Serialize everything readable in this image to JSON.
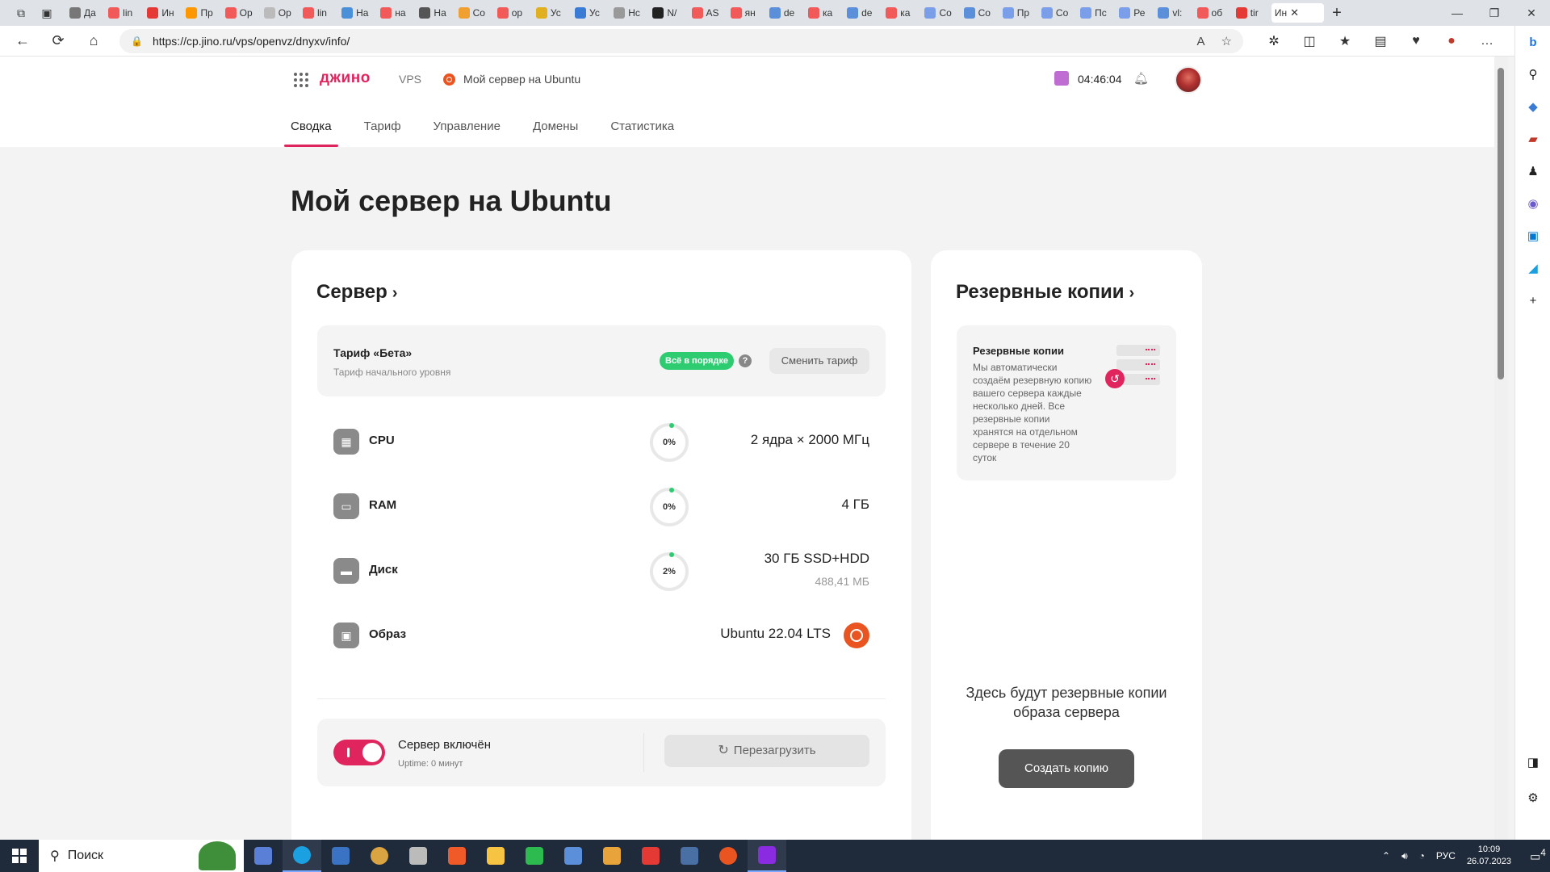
{
  "browser": {
    "tabs": [
      {
        "label": "Да",
        "color": "#777"
      },
      {
        "label": "lin",
        "color": "#f25a5a"
      },
      {
        "label": "Ин",
        "color": "#e53935"
      },
      {
        "label": "Пр",
        "color": "#ff9800"
      },
      {
        "label": "Ор",
        "color": "#f25a5a"
      },
      {
        "label": "Ор",
        "color": "#bbb"
      },
      {
        "label": "lin",
        "color": "#f25a5a"
      },
      {
        "label": "На",
        "color": "#4a90d9"
      },
      {
        "label": "на",
        "color": "#f25a5a"
      },
      {
        "label": "На",
        "color": "#555"
      },
      {
        "label": "Co",
        "color": "#f0a030"
      },
      {
        "label": "ор",
        "color": "#f25a5a"
      },
      {
        "label": "Ус",
        "color": "#e0b020"
      },
      {
        "label": "Ус",
        "color": "#3a7bd5"
      },
      {
        "label": "Нс",
        "color": "#999"
      },
      {
        "label": "N/",
        "color": "#222"
      },
      {
        "label": "AS",
        "color": "#f25a5a"
      },
      {
        "label": "ян",
        "color": "#f25a5a"
      },
      {
        "label": "de",
        "color": "#5b8fd9"
      },
      {
        "label": "ка",
        "color": "#f25a5a"
      },
      {
        "label": "de",
        "color": "#5b8fd9"
      },
      {
        "label": "ка",
        "color": "#f25a5a"
      },
      {
        "label": "Co",
        "color": "#7a9ee8"
      },
      {
        "label": "Co",
        "color": "#5b8fd9"
      },
      {
        "label": "Пр",
        "color": "#7a9ee8"
      },
      {
        "label": "Co",
        "color": "#7a9ee8"
      },
      {
        "label": "Пс",
        "color": "#7a9ee8"
      },
      {
        "label": "Ре",
        "color": "#7a9ee8"
      },
      {
        "label": "vl:",
        "color": "#5b8fd9"
      },
      {
        "label": "об",
        "color": "#f25a5a"
      },
      {
        "label": "tir",
        "color": "#e53935"
      }
    ],
    "active_tab": "Ин",
    "url": "https://cp.jino.ru/vps/openvz/dnyxv/info/"
  },
  "header": {
    "logo": "джино",
    "crumb_vps": "VPS",
    "crumb_server": "Мой сервер на Ubuntu",
    "time": "04:46:04",
    "tabs": [
      "Сводка",
      "Тариф",
      "Управление",
      "Домены",
      "Статистика"
    ]
  },
  "page": {
    "title": "Мой сервер на Ubuntu"
  },
  "server": {
    "title": "Сервер",
    "tariff_name": "Тариф «Бета»",
    "tariff_desc": "Тариф начального уровня",
    "status_badge": "Всё в порядке",
    "change_tariff": "Сменить тариф",
    "resources": [
      {
        "label": "CPU",
        "percent": "0%",
        "value": "2 ядра × 2000 МГц",
        "sub": ""
      },
      {
        "label": "RAM",
        "percent": "0%",
        "value": "4 ГБ",
        "sub": ""
      },
      {
        "label": "Диск",
        "percent": "2%",
        "value": "30 ГБ SSD+HDD",
        "sub": "488,41 МБ"
      }
    ],
    "image_label": "Образ",
    "image_value": "Ubuntu 22.04 LTS",
    "power_label": "Сервер включён",
    "uptime": "Uptime: 0 минут",
    "reboot": "Перезагрузить"
  },
  "backups": {
    "title": "Резервные копии",
    "box_title": "Резервные копии",
    "box_text": "Мы автоматически создаём резервную копию вашего сервера каждые несколько дней. Все резервные копии хранятся на отдельном сервере в течение 20 суток",
    "empty_text": "Здесь будут резервные копии образа сервера",
    "create_button": "Создать копию"
  },
  "taskbar": {
    "search": "Поиск",
    "lang": "РУС",
    "time": "10:09",
    "date": "26.07.2023",
    "notifications": "4"
  }
}
